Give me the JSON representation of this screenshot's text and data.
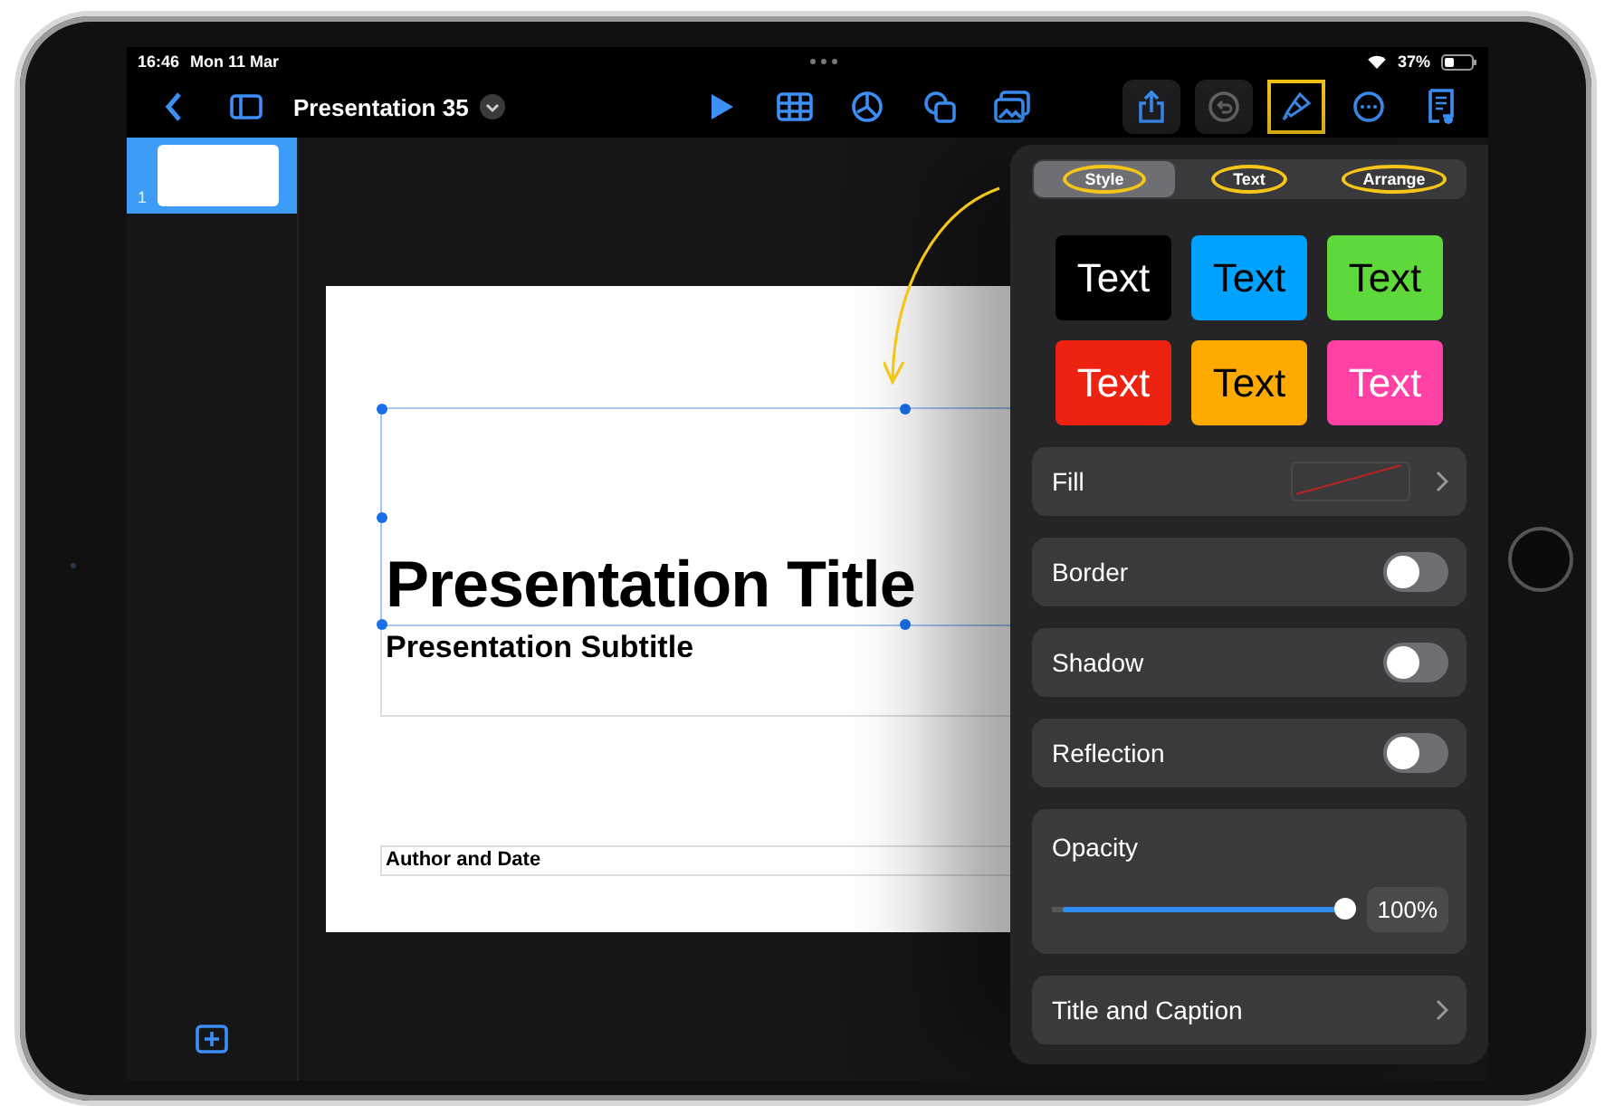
{
  "status_bar": {
    "time": "16:46",
    "date": "Mon 11 Mar",
    "battery": "37%"
  },
  "toolbar": {
    "title": "Presentation 35",
    "undo": {
      "disabled": true
    },
    "format": {
      "selected": true,
      "highlighted": true
    }
  },
  "slides": [
    {
      "number": "1",
      "selected": true
    }
  ],
  "slide": {
    "title": "Presentation Title",
    "subtitle": "Presentation Subtitle",
    "footer": "Author and Date",
    "title_selected": true
  },
  "popover": {
    "tabs": [
      {
        "label": "Style",
        "selected": true,
        "highlighted": true
      },
      {
        "label": "Text",
        "selected": false,
        "highlighted": true
      },
      {
        "label": "Arrange",
        "selected": false,
        "highlighted": true
      }
    ],
    "styles": [
      {
        "label": "Text",
        "color": "#000000",
        "light_text": true
      },
      {
        "label": "Text",
        "color": "#00a2ff",
        "light_text": false
      },
      {
        "label": "Text",
        "color": "#5ed83a",
        "light_text": false
      },
      {
        "label": "Text",
        "color": "#ee2211",
        "light_text": true
      },
      {
        "label": "Text",
        "color": "#ffaa00",
        "light_text": false
      },
      {
        "label": "Text",
        "color": "#ff40a4",
        "light_text": true
      }
    ],
    "rows": [
      {
        "kind": "fill",
        "label": "Fill"
      },
      {
        "kind": "toggle",
        "label": "Border",
        "on": false
      },
      {
        "kind": "toggle",
        "label": "Shadow",
        "on": false
      },
      {
        "kind": "toggle",
        "label": "Reflection",
        "on": false
      },
      {
        "kind": "slider",
        "label": "Opacity",
        "level": 1,
        "reading": "100%"
      },
      {
        "kind": "link",
        "label": "Title and Caption"
      }
    ]
  }
}
